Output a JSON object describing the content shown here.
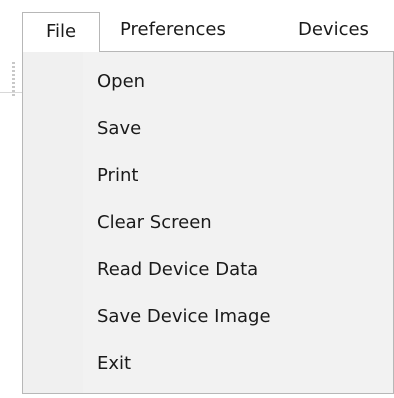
{
  "menubar": {
    "items": [
      "File",
      "Preferences",
      "Devices"
    ]
  },
  "file_menu": {
    "items": [
      "Open",
      "Save",
      "Print",
      "Clear Screen",
      "Read Device Data",
      "Save Device Image",
      "Exit"
    ]
  }
}
